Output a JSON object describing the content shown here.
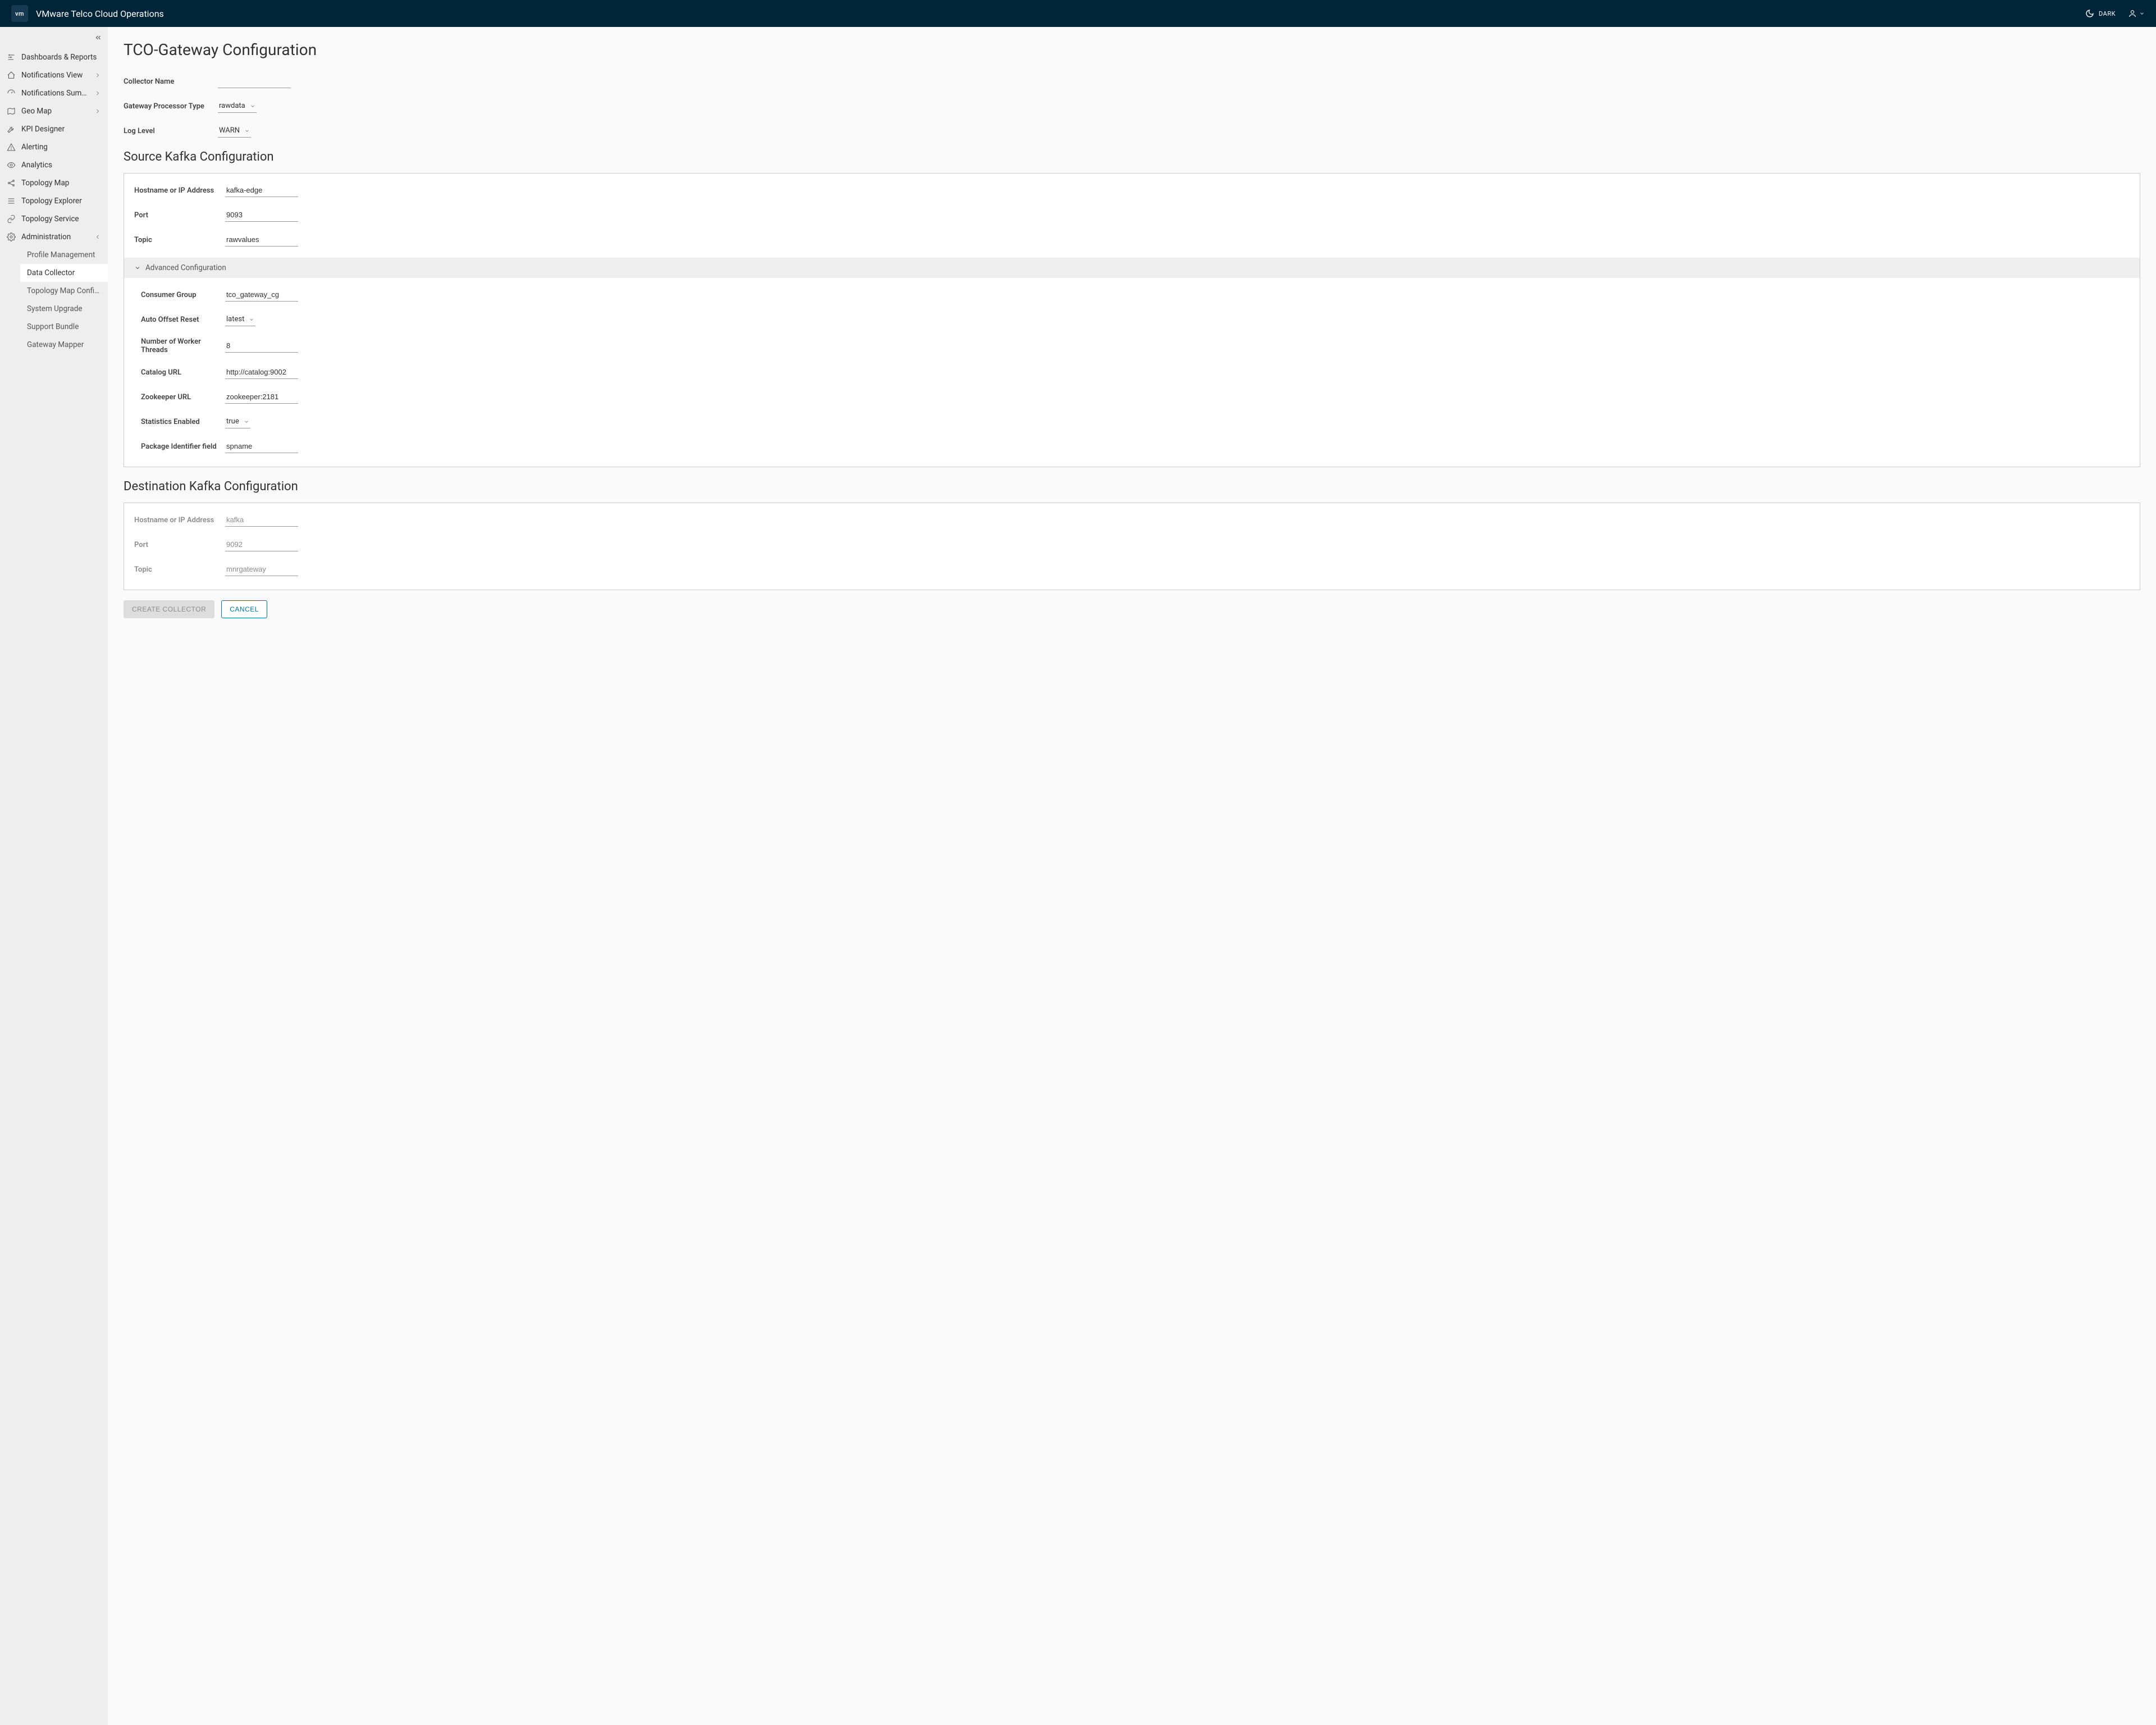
{
  "header": {
    "badge": "vm",
    "title": "VMware Telco Cloud Operations",
    "dark_label": "DARK"
  },
  "sidebar": {
    "items": [
      {
        "label": "Dashboards & Reports",
        "icon": "dashboards",
        "expandable": false
      },
      {
        "label": "Notifications View",
        "icon": "home",
        "expandable": true
      },
      {
        "label": "Notifications Summ…",
        "icon": "gauge",
        "expandable": true
      },
      {
        "label": "Geo Map",
        "icon": "map",
        "expandable": true
      },
      {
        "label": "KPI Designer",
        "icon": "wrench",
        "expandable": false
      },
      {
        "label": "Alerting",
        "icon": "alert",
        "expandable": false
      },
      {
        "label": "Analytics",
        "icon": "eye",
        "expandable": false
      },
      {
        "label": "Topology Map",
        "icon": "share",
        "expandable": false
      },
      {
        "label": "Topology Explorer",
        "icon": "list",
        "expandable": false
      },
      {
        "label": "Topology Service",
        "icon": "link",
        "expandable": false
      },
      {
        "label": "Administration",
        "icon": "gear",
        "expandable": true,
        "expanded": true
      }
    ],
    "admin_sub": [
      {
        "label": "Profile Management",
        "active": false
      },
      {
        "label": "Data Collector",
        "active": true
      },
      {
        "label": "Topology Map Configurat…",
        "active": false
      },
      {
        "label": "System Upgrade",
        "active": false
      },
      {
        "label": "Support Bundle",
        "active": false
      },
      {
        "label": "Gateway Mapper",
        "active": false
      }
    ]
  },
  "page": {
    "title": "TCO-Gateway Configuration",
    "labels": {
      "collector_name": "Collector Name",
      "gateway_processor_type": "Gateway Processor Type",
      "log_level": "Log Level",
      "source_section": "Source Kafka Configuration",
      "dest_section": "Destination Kafka Configuration",
      "hostname": "Hostname or IP Address",
      "port": "Port",
      "topic": "Topic",
      "advanced": "Advanced Configuration",
      "consumer_group": "Consumer Group",
      "auto_offset": "Auto Offset Reset",
      "worker_threads": "Number of Worker Threads",
      "catalog_url": "Catalog URL",
      "zookeeper_url": "Zookeeper URL",
      "stats_enabled": "Statistics Enabled",
      "pkg_id_field": "Package Identifier field"
    },
    "values": {
      "collector_name": "",
      "gateway_processor_type": "rawdata",
      "log_level": "WARN",
      "src_hostname": "kafka-edge",
      "src_port": "9093",
      "src_topic": "rawvalues",
      "consumer_group": "tco_gateway_cg",
      "auto_offset": "latest",
      "worker_threads": "8",
      "catalog_url": "http://catalog:9002",
      "zookeeper_url": "zookeeper:2181",
      "stats_enabled": "true",
      "pkg_id_field": "spname",
      "dst_hostname": "kafka",
      "dst_port": "9092",
      "dst_topic": "mnrgateway"
    },
    "buttons": {
      "create": "CREATE COLLECTOR",
      "cancel": "CANCEL"
    }
  }
}
